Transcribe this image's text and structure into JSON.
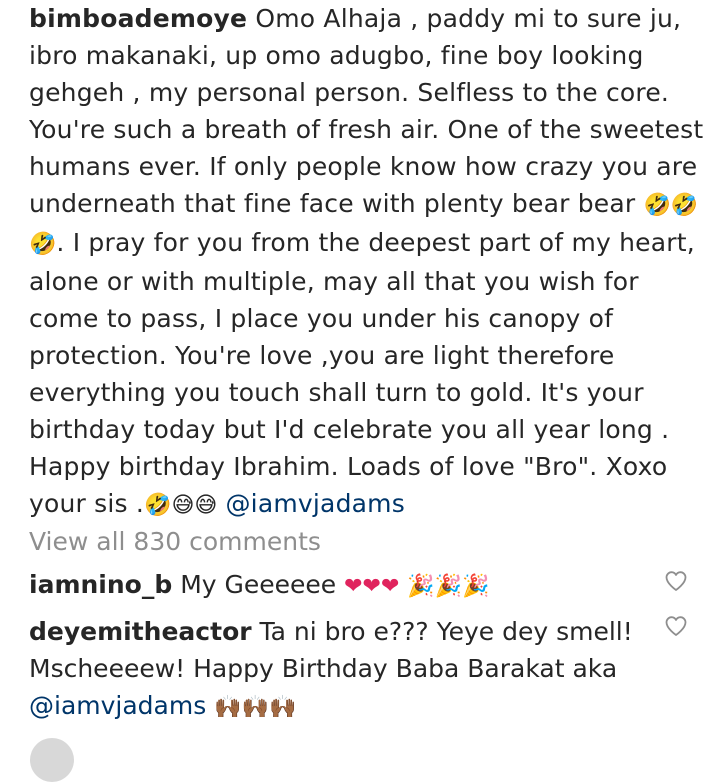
{
  "post": {
    "author": "bimboademoye",
    "caption_text": "Omo Alhaja , paddy mi to sure ju, ibro makanaki, up omo adugbo, fine boy looking gehgeh , my personal person. Selfless to the core. You're such a breath of fresh air. One of the sweetest humans ever. If only people know how crazy you are underneath that fine face with plenty bear bear",
    "caption_emoji_1": "🤣🤣",
    "caption_emoji_2": "🤣",
    "caption_text_2": ". I pray for you from the deepest part of my heart, alone or with multiple,  may all that you wish for come to pass, I place you under his canopy of protection. You're love ,you are light therefore everything you touch shall turn  to gold. It's your birthday today but I'd celebrate you all year long . Happy birthday Ibrahim. Loads of love \"Bro\". Xoxo your sis .",
    "caption_emoji_3": "🤣😅😅",
    "mention": "@iamvjadams"
  },
  "view_all_comments": "View all 830 comments",
  "comments": [
    {
      "username": "iamnino_b",
      "text": "My Geeeeee",
      "emoji_hearts": "❤❤❤",
      "emoji_party": "🎉🎉🎉"
    },
    {
      "username": "deyemitheactor",
      "text": "Ta ni bro e??? Yeye dey smell! Mscheeeew! Happy Birthday Baba Barakat aka",
      "mention": "@iamvjadams",
      "emoji": "🙌🏾🙌🏾🙌🏾"
    }
  ],
  "icons": {
    "like": "heart-outline-icon"
  }
}
